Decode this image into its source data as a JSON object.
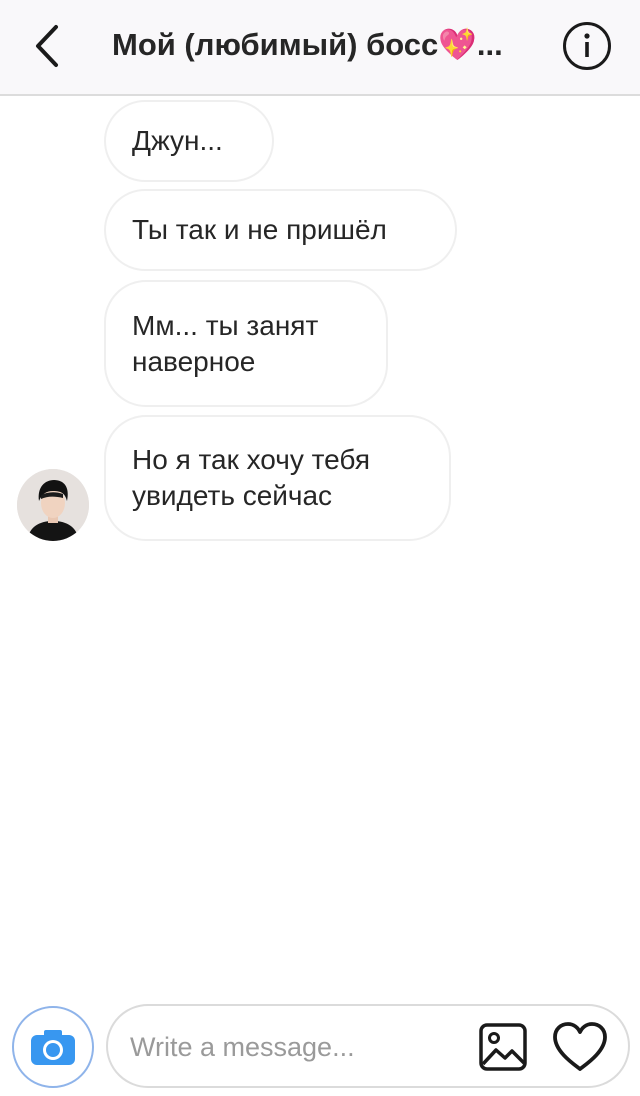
{
  "header": {
    "back_icon": "chevron-left-icon",
    "title": "Мой (любимый) босс💖...",
    "info_icon": "info-icon"
  },
  "messages": [
    {
      "lines": [
        "Джун..."
      ]
    },
    {
      "lines": [
        "Ты так и не пришёл"
      ]
    },
    {
      "lines": [
        "Мм... ты занят",
        "наверное"
      ]
    },
    {
      "lines": [
        "Но я так хочу тебя",
        "увидеть сейчас"
      ]
    }
  ],
  "composer": {
    "camera_icon": "camera-icon",
    "placeholder": "Write a message...",
    "value": "",
    "gallery_icon": "image-icon",
    "like_icon": "heart-icon"
  },
  "colors": {
    "header_bg": "#f9f8fa",
    "camera_accent": "#3897f0",
    "text": "#262626",
    "placeholder": "#9a9a9a"
  }
}
